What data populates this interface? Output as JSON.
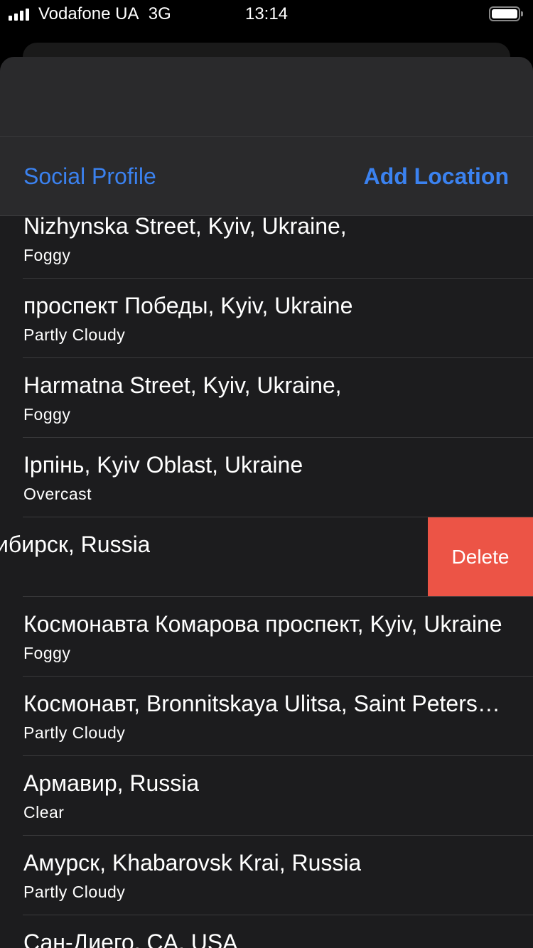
{
  "status_bar": {
    "carrier": "Vodafone UA",
    "network": "3G",
    "time": "13:14"
  },
  "nav": {
    "left_label": "Social Profile",
    "right_label": "Add Location"
  },
  "rows": [
    {
      "title": "Nizhynska Street, Kyiv, Ukraine,",
      "subtitle": "Foggy"
    },
    {
      "title": "проспект Победы, Kyiv, Ukraine",
      "subtitle": "Partly Cloudy"
    },
    {
      "title": "Harmatna Street, Kyiv, Ukraine,",
      "subtitle": "Foggy"
    },
    {
      "title": "Ірпінь, Kyiv Oblast, Ukraine",
      "subtitle": "Overcast"
    },
    {
      "title": "ибирск, Russia",
      "subtitle": "",
      "delete_label": "Delete"
    },
    {
      "title": "Космонавта Комарова проспект, Kyiv, Ukraine",
      "subtitle": "Foggy"
    },
    {
      "title": "Космонавт, Bronnitskaya Ulitsa, Saint Petersburg",
      "subtitle": "Partly Cloudy"
    },
    {
      "title": "Армавир, Russia",
      "subtitle": "Clear"
    },
    {
      "title": "Амурск, Khabarovsk Krai, Russia",
      "subtitle": "Partly Cloudy"
    },
    {
      "title": "Сан-Диего, CA, USA",
      "subtitle": ""
    }
  ],
  "colors": {
    "accent": "#3b82f0",
    "delete": "#ec5446",
    "background": "#1c1c1e"
  }
}
